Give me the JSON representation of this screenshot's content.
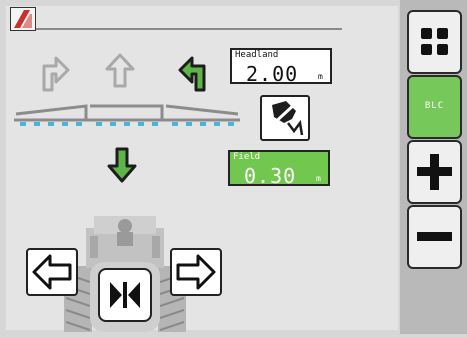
{
  "headland": {
    "label": "Headland",
    "value": "2.00",
    "unit": "m"
  },
  "field": {
    "label": "Field",
    "value": "0.30",
    "unit": "m"
  },
  "softkeys": {
    "blc_label": "BLC"
  },
  "colors": {
    "accent_green": "#72c84e",
    "active_arrow_green": "#5db548",
    "inactive_gray": "#a9a9a9",
    "boom_gray": "#8c8c8c",
    "nozzle_blue": "#4fb3d9",
    "logo_red": "#c8312d"
  },
  "icons": {
    "logo": "brand-logo-icon",
    "menu": "grid-menu-icon",
    "plus": "plus-icon",
    "minus": "minus-icon",
    "left": "arrow-left-icon",
    "right": "arrow-right-icon",
    "center": "center-collapse-icon",
    "boom": "boom-hand-icon"
  }
}
